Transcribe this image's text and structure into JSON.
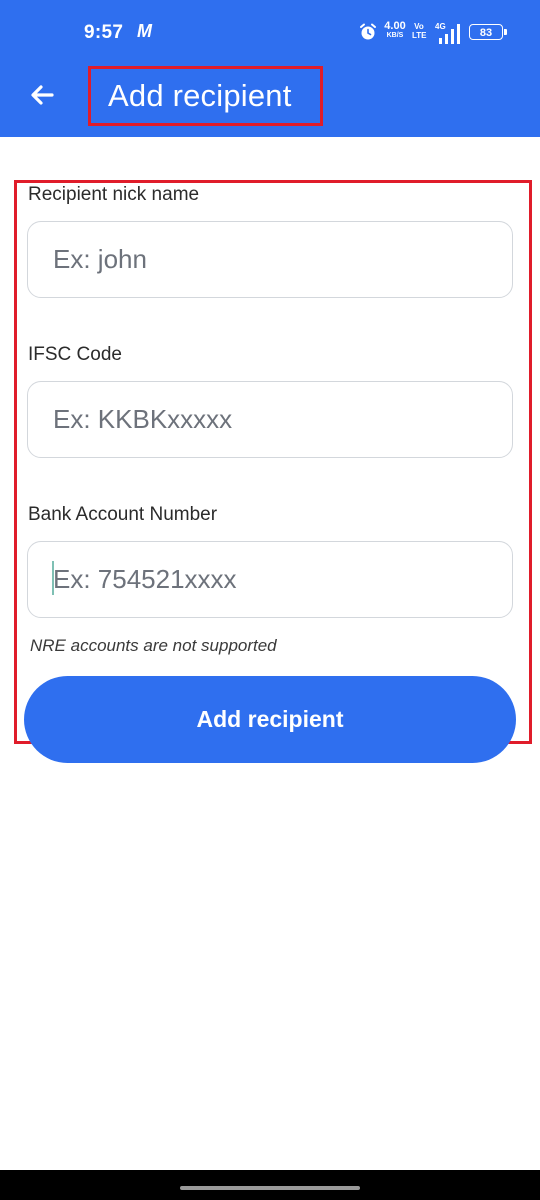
{
  "status_bar": {
    "time": "9:57",
    "app_indicator": "M",
    "speed_value": "4.00",
    "speed_unit": "KB/S",
    "volte_top": "Vo",
    "volte_bottom": "LTE",
    "network_type": "4G",
    "battery_level": "83"
  },
  "header": {
    "title": "Add recipient",
    "back_icon": "arrow-left-icon"
  },
  "form": {
    "nickname": {
      "label": "Recipient nick name",
      "placeholder": "Ex: john",
      "value": ""
    },
    "ifsc": {
      "label": "IFSC Code",
      "placeholder": "Ex: KKBKxxxxx",
      "value": ""
    },
    "account_number": {
      "label": "Bank Account Number",
      "placeholder": "Ex: 754521xxxx",
      "value": ""
    },
    "note": "NRE accounts are not supported",
    "submit_label": "Add recipient"
  },
  "colors": {
    "primary": "#2f6fef",
    "highlight_border": "#e01c2a",
    "input_border": "#d3d7dc",
    "placeholder": "#6d727b"
  }
}
